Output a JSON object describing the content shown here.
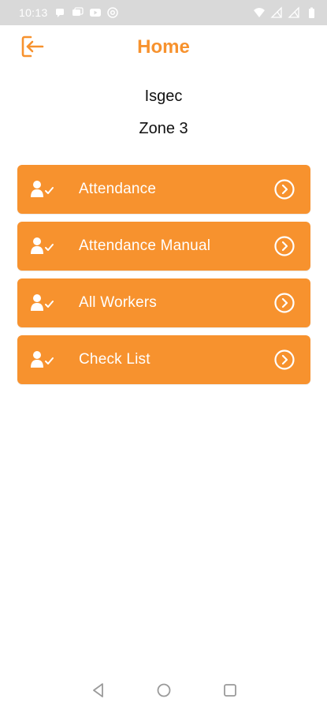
{
  "status_bar": {
    "time": "10:13",
    "left_icons": [
      "chat-icon",
      "chat-icon",
      "youtube-icon",
      "at-icon"
    ],
    "right_icons": [
      "wifi-icon",
      "signal-icon",
      "signal-icon",
      "battery-icon"
    ]
  },
  "header": {
    "title": "Home",
    "logout_icon": "logout-icon"
  },
  "info": {
    "company": "Isgec",
    "zone": "Zone 3"
  },
  "menu": {
    "items": [
      {
        "label": "Attendance"
      },
      {
        "label": "Attendance Manual"
      },
      {
        "label": "All Workers"
      },
      {
        "label": "Check List"
      }
    ]
  },
  "colors": {
    "accent": "#f7922e",
    "status_bar": "#d9d9d9"
  },
  "nav": {
    "icons": [
      "back-icon",
      "home-icon",
      "recents-icon"
    ]
  }
}
